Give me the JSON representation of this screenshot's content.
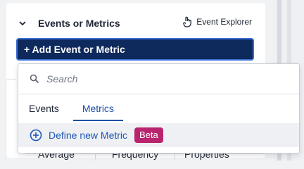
{
  "panel": {
    "title": "Events or Metrics",
    "explorer_label": "Event Explorer",
    "add_button_label": "+ Add Event or Metric"
  },
  "dropdown": {
    "search_placeholder": "Search",
    "tabs": [
      {
        "label": "Events",
        "active": false
      },
      {
        "label": "Metrics",
        "active": true
      }
    ],
    "define_label": "Define new Metric",
    "beta_badge": "Beta"
  },
  "background_columns": [
    "Average",
    "Frequency",
    "Properties"
  ],
  "colors": {
    "primary_button": "#0e2a5c",
    "accent_blue": "#1f4fa6",
    "beta_badge": "#b8246e"
  },
  "icons": [
    "chevron-down-icon",
    "event-explorer-icon",
    "search-icon",
    "plus-circle-icon"
  ]
}
